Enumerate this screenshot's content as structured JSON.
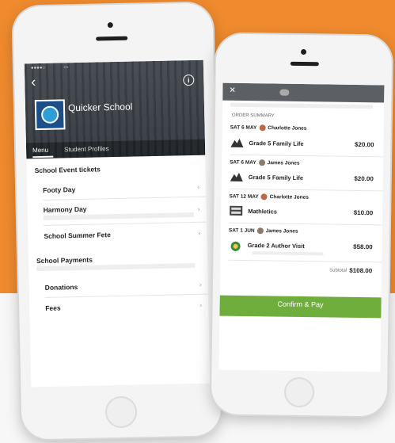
{
  "left_phone": {
    "school_name": "Quicker School",
    "tabs": [
      "Menu",
      "Student Profiles"
    ],
    "sections": {
      "event_tickets": "School Event tickets",
      "payments": "School Payments"
    },
    "items": {
      "footy_day": "Footy Day",
      "harmony_day": "Harmony Day",
      "summer_fete": "School Summer Fete",
      "donations": "Donations",
      "fees": "Fees"
    }
  },
  "right_phone": {
    "order_summary": "ORDER SUMMARY",
    "groups": [
      {
        "date": "SAT 6 MAY",
        "student": "Charlotte Jones",
        "item": "Grade 5 Family Life",
        "price": "$20.00"
      },
      {
        "date": "SAT 6 MAY",
        "student": "James Jones",
        "item": "Grade 5 Family Life",
        "price": "$20.00"
      },
      {
        "date": "SAT 12 MAY",
        "student": "Charlotte Jones",
        "item": "Mathletics",
        "price": "$10.00"
      },
      {
        "date": "SAT 1 JUN",
        "student": "James Jones",
        "item": "Grade 2 Author Visit",
        "price": "$58.00"
      }
    ],
    "subtotal_label": "Subtotal",
    "subtotal_value": "$108.00",
    "confirm_label": "Confirm & Pay"
  },
  "colors": {
    "brand_orange": "#ef8a2e",
    "header_gray": "#3b4046",
    "confirm_green": "#6fae3c"
  }
}
